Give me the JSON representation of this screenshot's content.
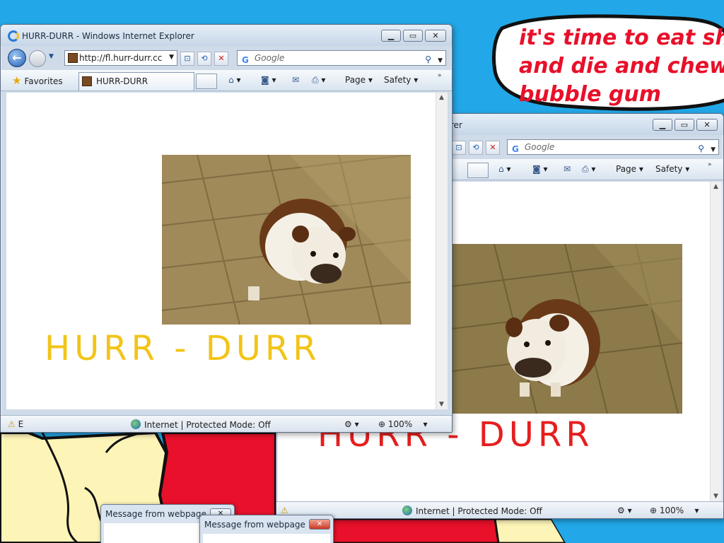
{
  "speech_bubble": {
    "text": "it's time to eat shit\nand die and chew\nbubble gum"
  },
  "window_front": {
    "title": "HURR-DURR - Windows Internet Explorer",
    "address": "http://fl.hurr-durr.cc",
    "search_placeholder": "Google",
    "favorites_label": "Favorites",
    "tab_label": "HURR-DURR",
    "page_menu": "Page",
    "safety_menu": "Safety",
    "banner_text": "HURR - DURR",
    "banner_color": "#f2c418",
    "status_left": "E",
    "status_zone": "Internet | Protected Mode: Off",
    "zoom": "100%"
  },
  "window_back": {
    "title_fragment": "rer",
    "search_placeholder": "Google",
    "page_menu": "Page",
    "safety_menu": "Safety",
    "banner_text": "HURR - DURR",
    "banner_color": "#e61e1e",
    "status_zone": "Internet | Protected Mode: Off",
    "zoom": "100%"
  },
  "dialogs": [
    {
      "title": "Message from webpage"
    },
    {
      "title": "Message from webpage"
    }
  ],
  "colors": {
    "desktop_blue": "#22a8e8",
    "paint_red": "#e8102a",
    "paint_yellow": "#fdf5b8"
  }
}
